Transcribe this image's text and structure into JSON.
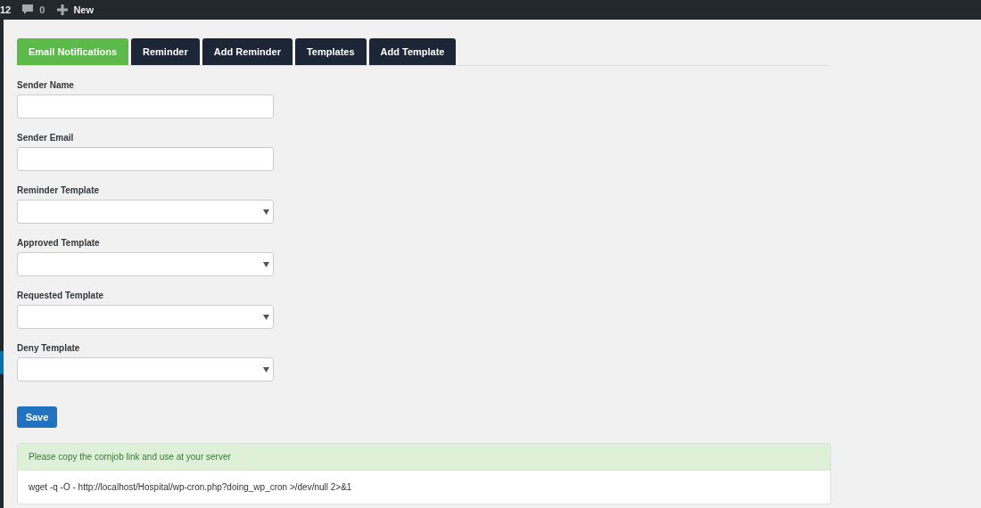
{
  "admin_bar": {
    "updates": "12",
    "comments": "0",
    "new_label": "New"
  },
  "tabs": [
    {
      "label": "Email Notifications",
      "selected": true
    },
    {
      "label": "Reminder",
      "selected": false
    },
    {
      "label": "Add Reminder",
      "selected": false
    },
    {
      "label": "Templates",
      "selected": false
    },
    {
      "label": "Add Template",
      "selected": false
    }
  ],
  "fields": [
    {
      "label": "Sender Name",
      "kind": "text"
    },
    {
      "label": "Sender Email",
      "kind": "text"
    },
    {
      "label": "Reminder Template",
      "kind": "select"
    },
    {
      "label": "Approved Template",
      "kind": "select"
    },
    {
      "label": "Requested Template",
      "kind": "select"
    },
    {
      "label": "Deny Template",
      "kind": "select"
    }
  ],
  "save_button": "Save",
  "cron_panel": {
    "heading": "Please copy the cornjob link and use at your server",
    "command": "wget -q -O - http://localhost/Hospital/wp-cron.php?doing_wp_cron >/dev/null 2>&1"
  }
}
